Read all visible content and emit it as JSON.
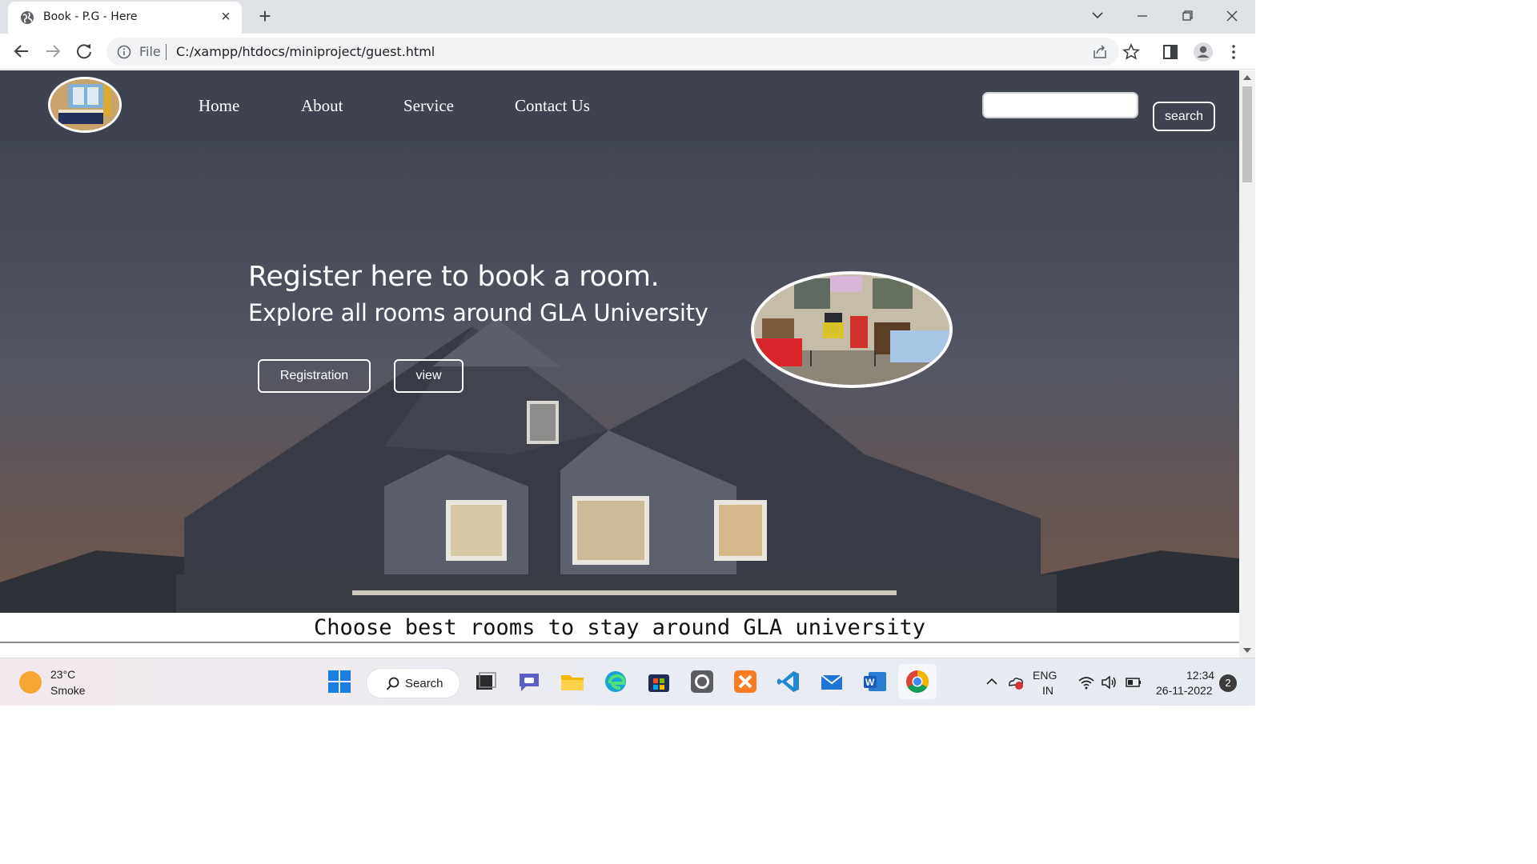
{
  "browser": {
    "tab_title": "Book - P.G - Here",
    "omnibox_scheme": "File",
    "url": "C:/xampp/htdocs/miniproject/guest.html"
  },
  "site": {
    "nav": [
      "Home",
      "About",
      "Service",
      "Contact Us"
    ],
    "search_button": "search",
    "search_value": "",
    "headline": "Register here to book a room.",
    "subheadline": "Explore all rooms around GLA University",
    "buttons": [
      "Registration",
      "view"
    ],
    "tagline": "Choose best rooms to stay around GLA university"
  },
  "taskbar": {
    "weather_temp": "23°C",
    "weather_desc": "Smoke",
    "search_label": "Search",
    "lang_1": "ENG",
    "lang_2": "IN",
    "time": "12:34",
    "date": "26-11-2022",
    "notification_count": "2"
  },
  "icons": {
    "tab": "globe-icon",
    "browser": [
      "back-arrow-icon",
      "forward-arrow-icon",
      "reload-icon",
      "info-icon",
      "share-icon",
      "star-icon",
      "sidepanel-icon",
      "profile-icon",
      "menu-dots-icon"
    ],
    "taskbar_apps": [
      "windows-start-icon",
      "task-view-icon",
      "teams-chat-icon",
      "file-explorer-icon",
      "edge-icon",
      "store-icon",
      "github-desktop-icon",
      "xampp-icon",
      "vscode-icon",
      "mail-icon",
      "word-icon",
      "chrome-icon"
    ]
  }
}
